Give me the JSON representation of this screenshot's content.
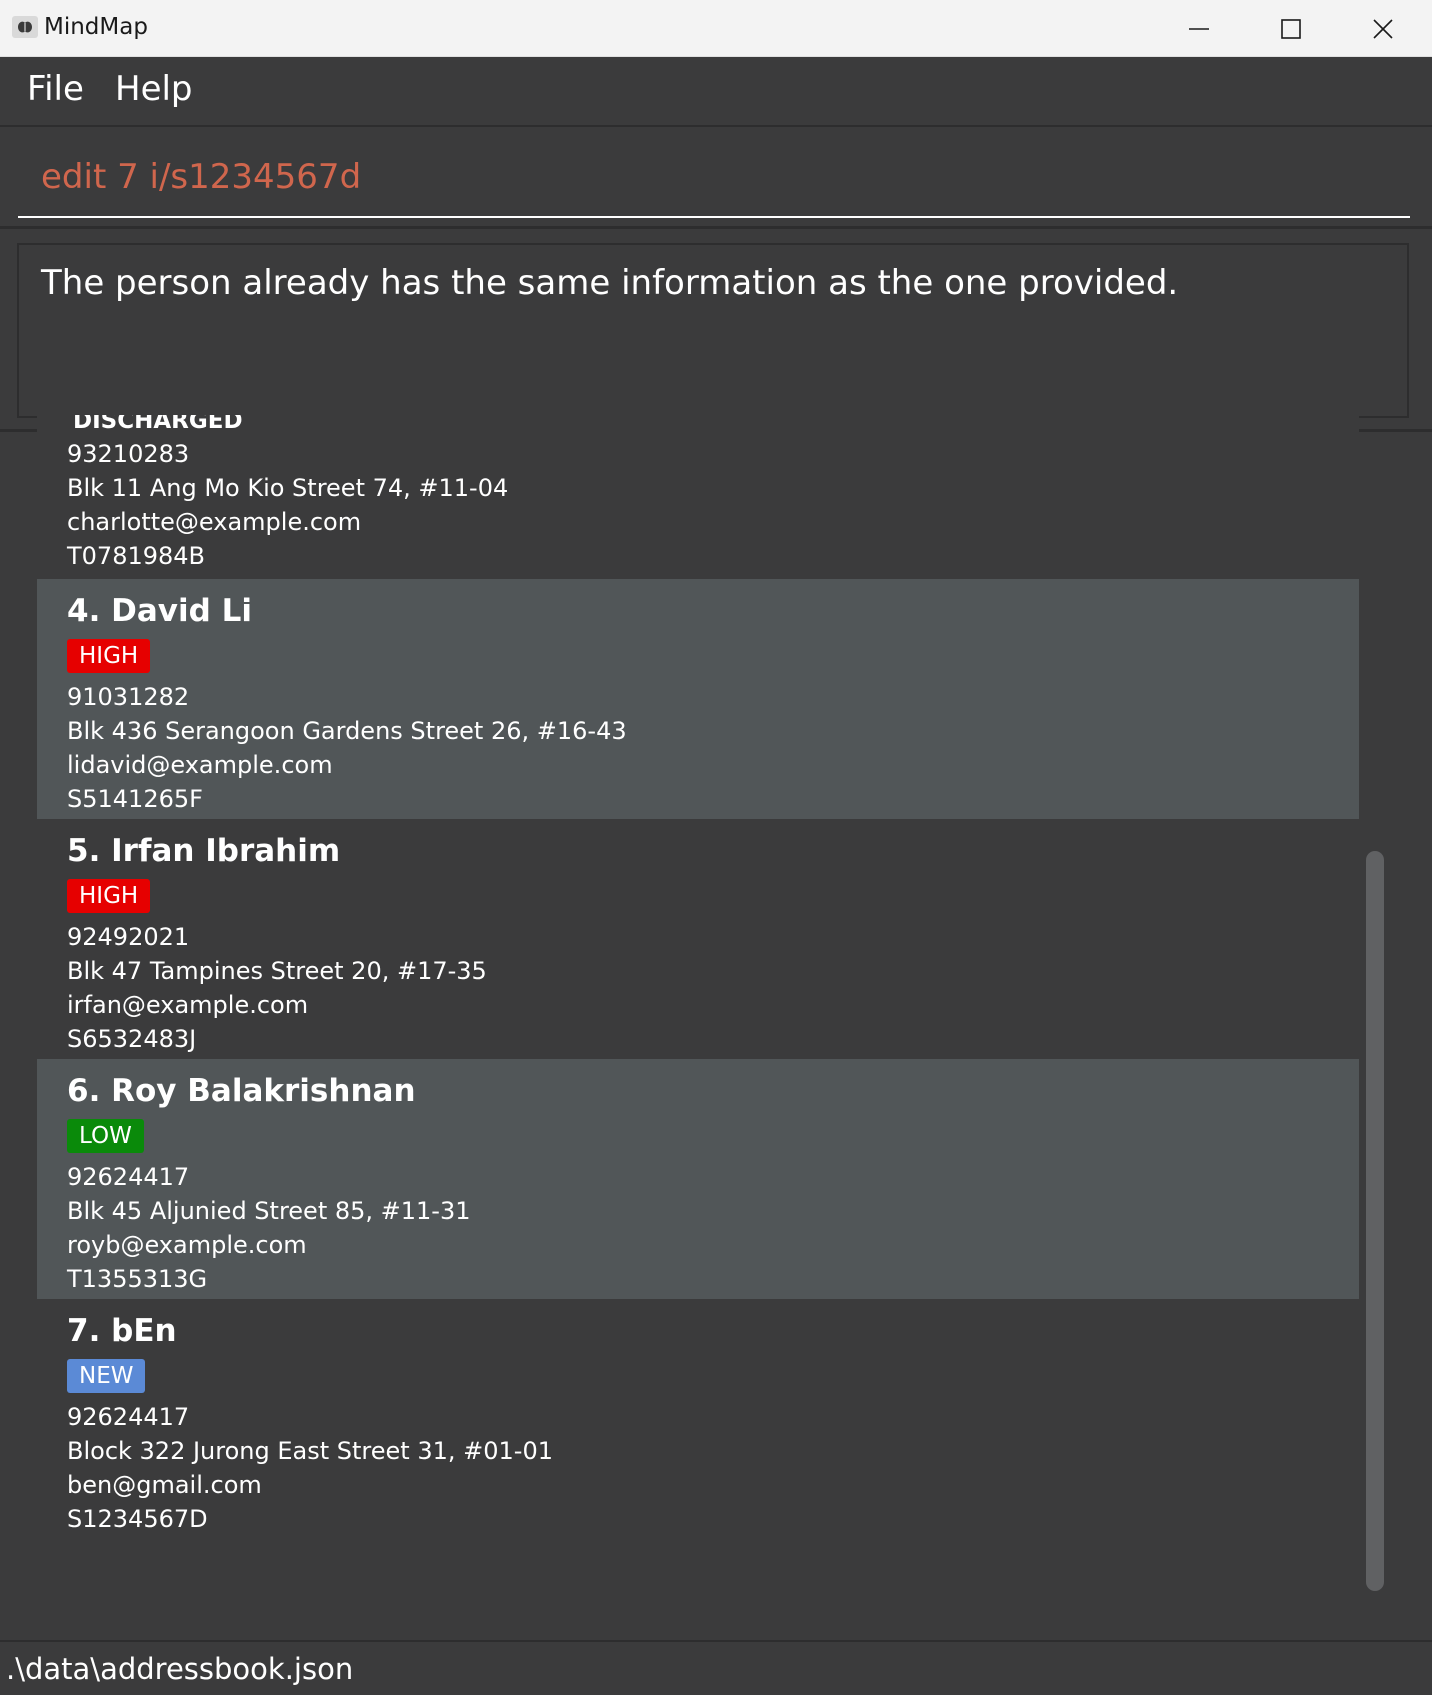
{
  "window": {
    "title": "MindMap",
    "app_icon": "brain-icon"
  },
  "menu": {
    "file": "File",
    "help": "Help"
  },
  "command": {
    "value": "edit 7 i/s1234567d"
  },
  "result": {
    "message": "The person already has the same information as the one provided."
  },
  "persons": {
    "partial": {
      "tag": "DISCHARGED",
      "phone": "93210283",
      "address": "Blk 11 Ang Mo Kio Street 74, #11-04",
      "email": "charlotte@example.com",
      "nric": "T0781984B"
    },
    "list": [
      {
        "name": "4. David Li",
        "tag": "HIGH",
        "tag_color": "#e60000",
        "phone": "91031282",
        "address": "Blk 436 Serangoon Gardens Street 26, #16-43",
        "email": "lidavid@example.com",
        "nric": "S5141265F"
      },
      {
        "name": "5. Irfan Ibrahim",
        "tag": "HIGH",
        "tag_color": "#e60000",
        "phone": "92492021",
        "address": "Blk 47 Tampines Street 20, #17-35",
        "email": "irfan@example.com",
        "nric": "S6532483J"
      },
      {
        "name": "6. Roy Balakrishnan",
        "tag": "LOW",
        "tag_color": "#0a8a0a",
        "phone": "92624417",
        "address": "Blk 45 Aljunied Street 85, #11-31",
        "email": "royb@example.com",
        "nric": "T1355313G"
      },
      {
        "name": "7. bEn",
        "tag": "NEW",
        "tag_color": "#5b8ad6",
        "phone": "92624417",
        "address": "Block 322 Jurong East Street 31, #01-01",
        "email": "ben@gmail.com",
        "nric": "S1234567D"
      }
    ]
  },
  "status": {
    "path": ".\\data\\addressbook.json"
  },
  "colors": {
    "background": "#3b3b3c",
    "card_alt": "#515658",
    "command_text": "#d0664d"
  }
}
